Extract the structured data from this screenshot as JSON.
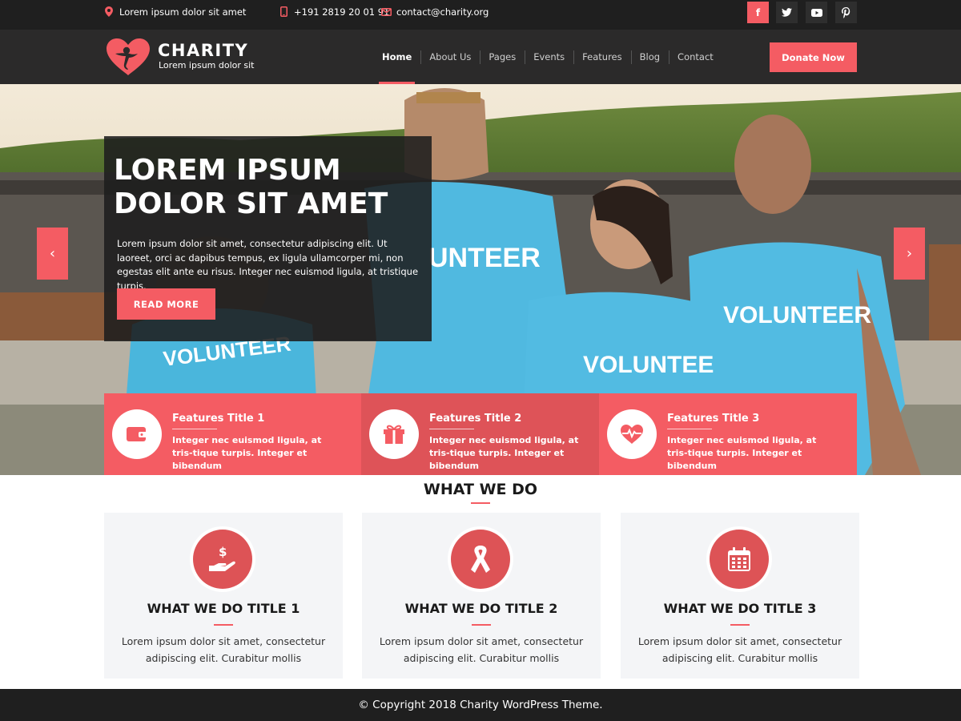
{
  "topbar": {
    "address": "Lorem ipsum dolor sit amet",
    "phone": "+191 2819 20 01 91",
    "email": "contact@charity.org",
    "social": [
      {
        "icon": "facebook-icon",
        "glyph": "f"
      },
      {
        "icon": "twitter-icon",
        "glyph": "t"
      },
      {
        "icon": "youtube-icon",
        "glyph": "▶"
      },
      {
        "icon": "pinterest-icon",
        "glyph": "p"
      }
    ]
  },
  "brand": {
    "name": "CHARITY",
    "tagline": "Lorem ipsum dolor sit"
  },
  "nav": {
    "items": [
      "Home",
      "About Us",
      "Pages",
      "Events",
      "Features",
      "Blog",
      "Contact"
    ],
    "active": "Home",
    "donate_label": "Donate Now"
  },
  "hero": {
    "title_line1": "LOREM IPSUM",
    "title_line2": "DOLOR SIT AMET",
    "text": "Lorem ipsum dolor sit amet, consectetur adipiscing elit. Ut laoreet, orci ac dapibus tempus, ex ligula ullamcorper mi, non egestas elit ante eu risus. Integer nec euismod ligula, at tristique turpis.",
    "button": "READ MORE",
    "prev_glyph": "‹",
    "next_glyph": "›",
    "shirt_text": "VOLUNTEER",
    "shirt_text_partial": "UNTEER",
    "shirt_text_partial2": "VOLUNTEE"
  },
  "features": [
    {
      "title": "Features Title 1",
      "text": "Integer nec euismod ligula, at tris-tique turpis. Integer et bibendum",
      "icon": "wallet-icon"
    },
    {
      "title": "Features Title 2",
      "text": "Integer nec euismod ligula, at tris-tique turpis. Integer et bibendum",
      "icon": "gift-icon"
    },
    {
      "title": "Features Title 3",
      "text": "Integer nec euismod ligula, at tris-tique turpis. Integer et bibendum",
      "icon": "heartbeat-icon"
    }
  ],
  "what_we_do": {
    "heading": "WHAT WE DO",
    "cards": [
      {
        "title": "WHAT WE DO TITLE 1",
        "text": "Lorem ipsum dolor sit amet, consectetur adipiscing elit. Curabitur mollis",
        "icon": "donation-hand-icon"
      },
      {
        "title": "WHAT WE DO TITLE 2",
        "text": "Lorem ipsum dolor sit amet, consectetur adipiscing elit. Curabitur mollis",
        "icon": "ribbon-icon"
      },
      {
        "title": "WHAT WE DO TITLE 3",
        "text": "Lorem ipsum dolor sit amet, consectetur adipiscing elit. Curabitur mollis",
        "icon": "calendar-icon"
      }
    ]
  },
  "footer": {
    "copyright": "© Copyright 2018 Charity WordPress Theme."
  },
  "colors": {
    "accent": "#f45c63",
    "accent_dark": "#de5358",
    "topbar_bg": "#1f1f1f",
    "nav_bg": "#2b2a2a",
    "card_bg": "#f4f5f7"
  }
}
